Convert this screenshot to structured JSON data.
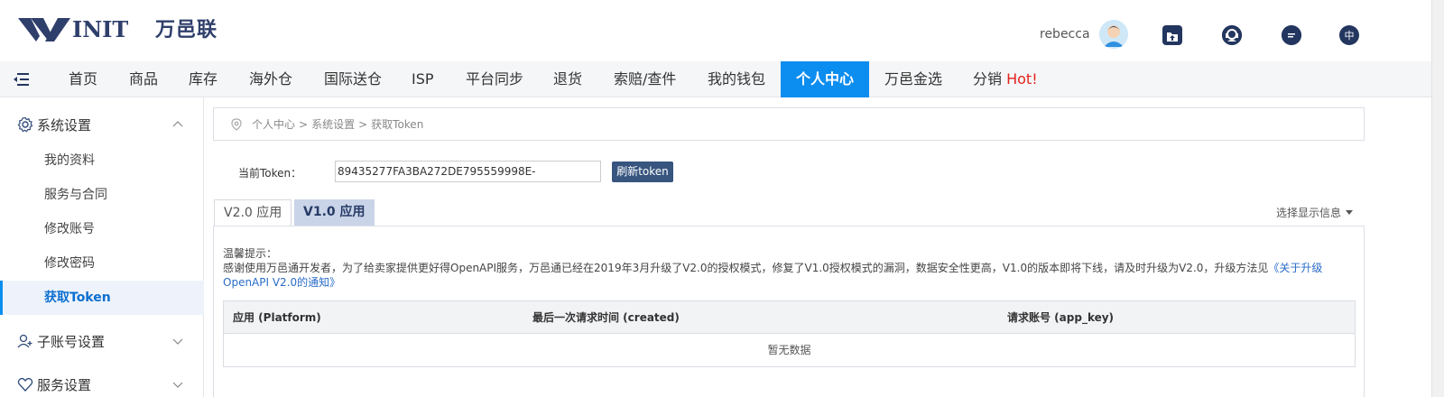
{
  "brand": {
    "logo_text": "INIT",
    "logo_cn": "万邑联"
  },
  "user": {
    "name": "rebecca"
  },
  "header_icons": {
    "upload": "upload-icon",
    "support": "headset-icon",
    "message": "chat-icon",
    "language": "中"
  },
  "nav": {
    "items": [
      "首页",
      "商品",
      "库存",
      "海外仓",
      "国际送仓",
      "ISP",
      "平台同步",
      "退货",
      "索赔/查件",
      "我的钱包",
      "个人中心",
      "万邑金选"
    ],
    "distribution": "分销",
    "hot": "Hot!",
    "active": "个人中心"
  },
  "sidebar": {
    "group1": "系统设置",
    "items": [
      "我的资料",
      "服务与合同",
      "修改账号",
      "修改密码",
      "获取Token"
    ],
    "active": "获取Token",
    "group2": "子账号设置",
    "group3": "服务设置"
  },
  "breadcrumb": {
    "p1": "个人中心",
    "p2": "系统设置",
    "p3": "获取Token",
    "sep": ">"
  },
  "token": {
    "label": "当前Token：",
    "value": "89435277FA3BA272DE795559998E-",
    "refresh": "刷新token"
  },
  "tabs": {
    "v2": "V2.0 应用",
    "v1": "V1.0 应用",
    "active": "V1.0 应用"
  },
  "select_info": "选择显示信息",
  "notice": {
    "title": "温馨提示：",
    "body": "感谢使用万邑通开发者，为了给卖家提供更好得OpenAPI服务，万邑通已经在2019年3月升级了V2.0的授权模式，修复了V1.0授权模式的漏洞，数据安全性更高，V1.0的版本即将下线，请及时升级为V2.0，升级方法见",
    "link": "《关于升级OpenAPI V2.0的通知》"
  },
  "table": {
    "headers": [
      "应用 (Platform)",
      "最后一次请求时间 (created)",
      "请求账号 (app_key)"
    ],
    "empty": "暂无数据"
  }
}
